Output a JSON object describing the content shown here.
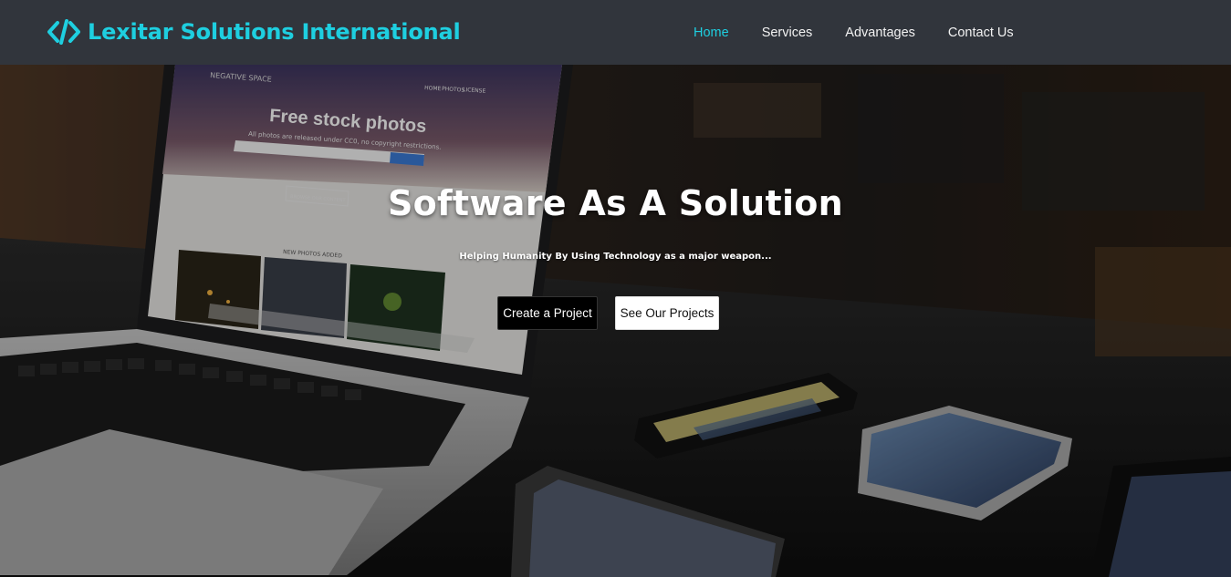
{
  "brand": {
    "name": "Lexitar Solutions International",
    "icon": "code-brackets-icon",
    "color": "#1ecfe0"
  },
  "nav": {
    "items": [
      {
        "label": "Home",
        "active": true
      },
      {
        "label": "Services",
        "active": false
      },
      {
        "label": "Advantages",
        "active": false
      },
      {
        "label": "Contact Us",
        "active": false
      }
    ]
  },
  "hero": {
    "title": "Software As A Solution",
    "subtitle": "Helping Humanity By Using Technology as a major weapon...",
    "primary_button": "Create a Project",
    "secondary_button": "See Our Projects"
  },
  "background_screen": {
    "site_name": "NEGATIVE SPACE",
    "menu": [
      "HOME",
      "PHOTOS",
      "LICENSE"
    ],
    "headline": "Free stock photos",
    "tagline": "All photos are released under CC0, no copyright restrictions.",
    "cta": "BROWSE OUR CONTENT",
    "section": "NEW PHOTOS ADDED"
  }
}
